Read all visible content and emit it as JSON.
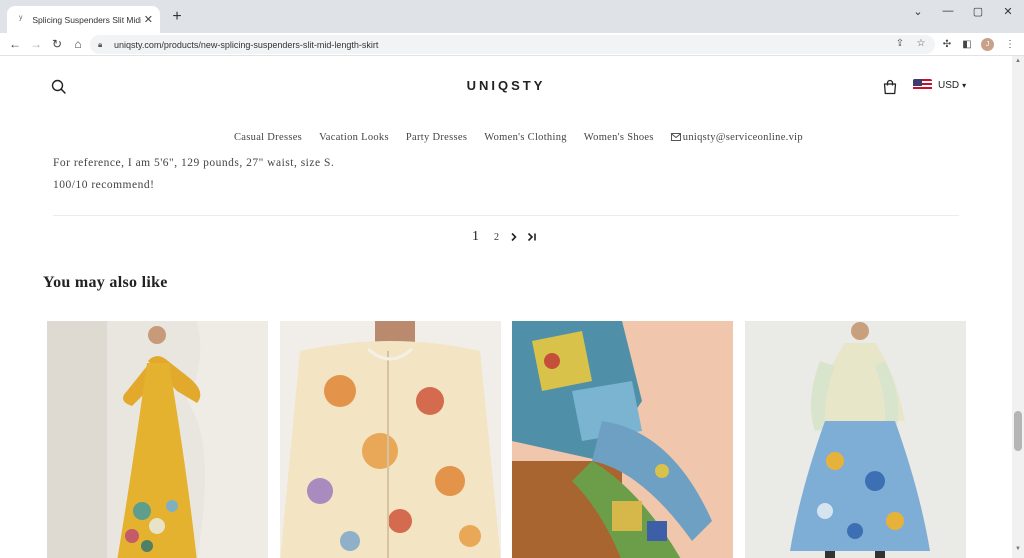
{
  "browser": {
    "tab_title": "Splicing Suspenders Slit Midi Dre",
    "url": "uniqsty.com/products/new-splicing-suspenders-slit-mid-length-skirt",
    "profile_initial": "J"
  },
  "header": {
    "brand": "UNIQSTY",
    "currency": "USD"
  },
  "nav": {
    "items": [
      {
        "label": "Casual Dresses"
      },
      {
        "label": "Vacation Looks"
      },
      {
        "label": "Party Dresses"
      },
      {
        "label": "Women's Clothing"
      },
      {
        "label": "Women's Shoes"
      }
    ],
    "email": "uniqsty@serviceonline.vip"
  },
  "review": {
    "line1": "For reference, I am 5'6\", 129 pounds, 27\" waist, size S.",
    "line2": "100/10 recommend!"
  },
  "pagination": {
    "current": "1",
    "next_page": "2"
  },
  "recommendations": {
    "title": "You may also like",
    "products": [
      {
        "image": "yellow floral maxi dress with ruffle sleeves"
      },
      {
        "image": "floral print button-up shirt"
      },
      {
        "image": "patchwork print shirt and pants set"
      },
      {
        "image": "blue floral tiered midi dress"
      }
    ]
  }
}
